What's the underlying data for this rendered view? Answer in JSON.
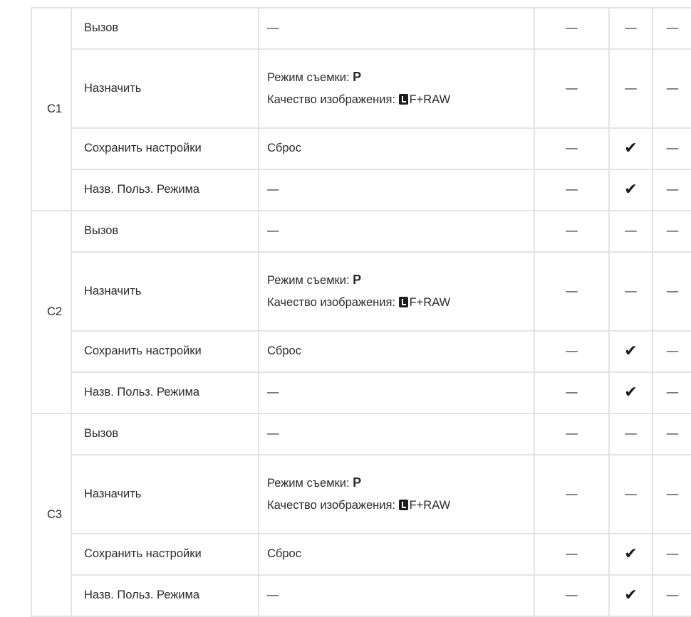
{
  "dash": "—",
  "groups": [
    {
      "label": "C1",
      "rows": [
        {
          "item": "Вызов",
          "value": "—",
          "c1": "—",
          "c2": "—",
          "c3": "—"
        },
        {
          "item": "Назначить",
          "value": {
            "line1_prefix": "Режим съемки: ",
            "line1_bold": "P",
            "line2_prefix": "Качество изображения: ",
            "line2_icon": "L-size-icon",
            "line2_suffix": "F+RAW"
          },
          "c1": "—",
          "c2": "—",
          "c3": "—"
        },
        {
          "item": "Сохранить настройки",
          "value": "Сброс",
          "c1": "—",
          "c2": "✔",
          "c3": "—"
        },
        {
          "item": "Назв. Польз. Режима",
          "value": "—",
          "c1": "—",
          "c2": "✔",
          "c3": "—"
        }
      ]
    },
    {
      "label": "C2",
      "rows": [
        {
          "item": "Вызов",
          "value": "—",
          "c1": "—",
          "c2": "—",
          "c3": "—"
        },
        {
          "item": "Назначить",
          "value": {
            "line1_prefix": "Режим съемки: ",
            "line1_bold": "P",
            "line2_prefix": "Качество изображения: ",
            "line2_icon": "L-size-icon",
            "line2_suffix": "F+RAW"
          },
          "c1": "—",
          "c2": "—",
          "c3": "—"
        },
        {
          "item": "Сохранить настройки",
          "value": "Сброс",
          "c1": "—",
          "c2": "✔",
          "c3": "—"
        },
        {
          "item": "Назв. Польз. Режима",
          "value": "—",
          "c1": "—",
          "c2": "✔",
          "c3": "—"
        }
      ]
    },
    {
      "label": "C3",
      "rows": [
        {
          "item": "Вызов",
          "value": "—",
          "c1": "—",
          "c2": "—",
          "c3": "—"
        },
        {
          "item": "Назначить",
          "value": {
            "line1_prefix": "Режим съемки: ",
            "line1_bold": "P",
            "line2_prefix": "Качество изображения: ",
            "line2_icon": "L-size-icon",
            "line2_suffix": "F+RAW"
          },
          "c1": "—",
          "c2": "—",
          "c3": "—"
        },
        {
          "item": "Сохранить настройки",
          "value": "Сброс",
          "c1": "—",
          "c2": "✔",
          "c3": "—"
        },
        {
          "item": "Назв. Польз. Режима",
          "value": "—",
          "c1": "—",
          "c2": "✔",
          "c3": "—"
        }
      ]
    }
  ]
}
